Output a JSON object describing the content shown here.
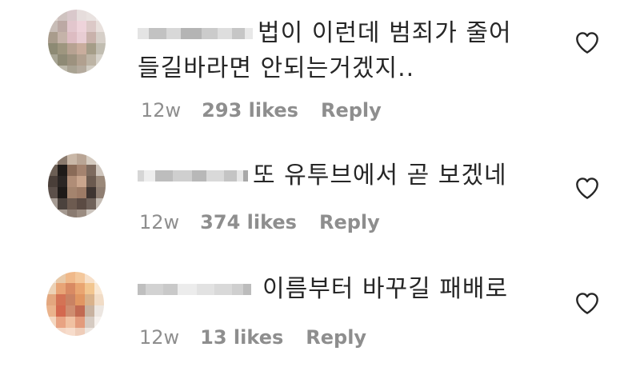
{
  "comments": [
    {
      "text_line1": "법이 이런데 범죄가 줄어",
      "text_line2": "들길바라면 안되는거겠지..",
      "time": "12w",
      "likes": "293 likes",
      "reply": "Reply"
    },
    {
      "text_line1": "또 유투브에서 곧 보겠네",
      "time": "12w",
      "likes": "374 likes",
      "reply": "Reply"
    },
    {
      "text_line1": "이름부터 바꾸길 패배로",
      "time": "12w",
      "likes": "13 likes",
      "reply": "Reply"
    }
  ],
  "icons": {
    "heart": "heart-outline-icon",
    "avatar": "pixelated-avatar",
    "username": "pixelated-username"
  },
  "colors": {
    "text": "#262626",
    "meta": "#8e8e8e",
    "background": "#ffffff"
  }
}
